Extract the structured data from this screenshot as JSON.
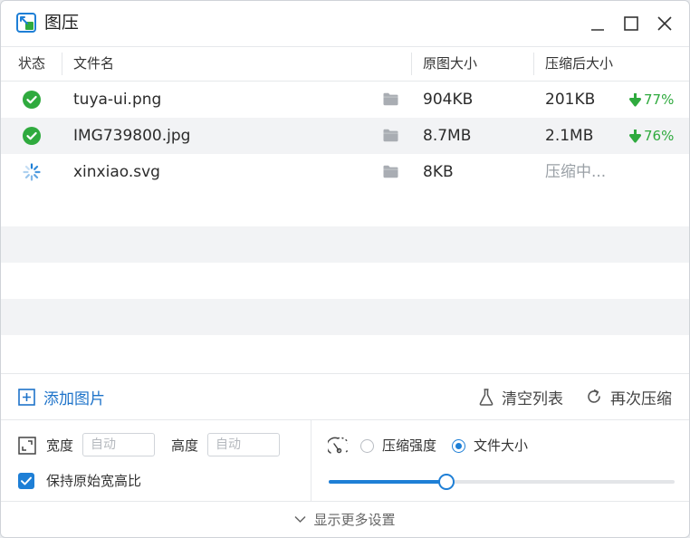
{
  "app": {
    "title": "图压"
  },
  "table": {
    "headers": {
      "status": "状态",
      "filename": "文件名",
      "original_size": "原图大小",
      "compressed_size": "压缩后大小"
    },
    "rows": [
      {
        "status": "done",
        "filename": "tuya-ui.png",
        "original_size": "904KB",
        "compressed_size": "201KB",
        "reduction": "77%"
      },
      {
        "status": "done",
        "filename": "IMG739800.jpg",
        "original_size": "8.7MB",
        "compressed_size": "2.1MB",
        "reduction": "76%"
      },
      {
        "status": "loading",
        "filename": "xinxiao.svg",
        "original_size": "8KB",
        "compressed_size": "压缩中..."
      }
    ]
  },
  "actions": {
    "add_images": "添加图片",
    "clear_list": "清空列表",
    "recompress": "再次压缩"
  },
  "settings": {
    "width_label": "宽度",
    "width_placeholder": "自动",
    "height_label": "高度",
    "height_placeholder": "自动",
    "keep_ratio_label": "保持原始宽高比",
    "keep_ratio_checked": true,
    "mode_options": [
      "压缩强度",
      "文件大小"
    ],
    "mode_selected": "文件大小",
    "slider_level": 0.34
  },
  "footer": {
    "more_settings": "显示更多设置"
  },
  "colors": {
    "accent": "#1e7fd6",
    "success": "#2faa3e",
    "link": "#1e73c9"
  },
  "icons": {
    "app": "image-compress-logo",
    "done": "check-circle-icon",
    "loading": "spinner-icon",
    "folder": "folder-icon",
    "reduction": "arrow-down-icon"
  }
}
